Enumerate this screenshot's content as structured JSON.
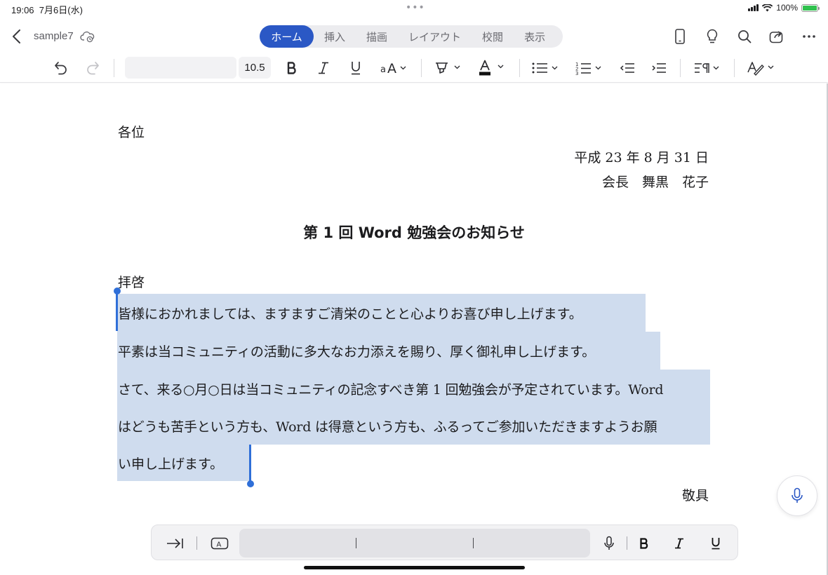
{
  "status": {
    "time": "19:06",
    "date": "7月6日(水)",
    "battery": "100%"
  },
  "titlebar": {
    "doc_name": "sample7",
    "tabs": [
      {
        "label": "ホーム",
        "active": true
      },
      {
        "label": "挿入"
      },
      {
        "label": "描画"
      },
      {
        "label": "レイアウト"
      },
      {
        "label": "校閲"
      },
      {
        "label": "表示"
      }
    ]
  },
  "ribbon": {
    "font_name": "",
    "font_size": "10.5",
    "font_color": "#111111"
  },
  "document": {
    "addressee": "各位",
    "date_line": "平成 23 年 8 月 31 日",
    "sender": "会長　舞黒　花子",
    "title": "第 1 回 Word 勉強会のお知らせ",
    "salutation": "拝啓",
    "lines": [
      "皆様におかれましては、ますますご清栄のことと心よりお喜び申し上げます。",
      "平素は当コミュニティの活動に多大なお力添えを賜り、厚く御礼申し上げます。",
      "さて、来る○月○日は当コミュニティの記念すべき第 1 回勉強会が予定されています。Word",
      "はどうも苦手という方も、Word は得意という方も、ふるってご参加いただきますようお願",
      "い申し上げます。"
    ],
    "closing": "敬具"
  },
  "colors": {
    "accent": "#2b58c5",
    "selection": "#cfdcee",
    "cursor": "#2f6fd8"
  }
}
